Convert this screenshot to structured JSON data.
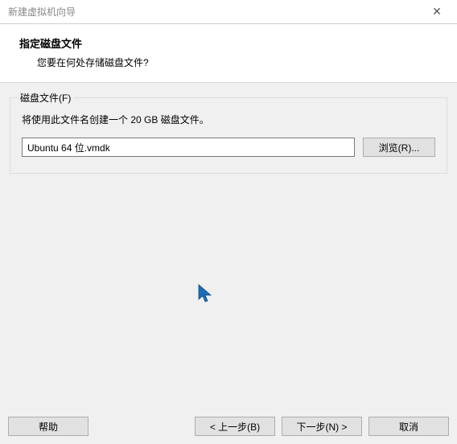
{
  "titlebar": {
    "title": "新建虚拟机向导"
  },
  "header": {
    "title": "指定磁盘文件",
    "subtitle": "您要在何处存储磁盘文件?"
  },
  "group": {
    "title": "磁盘文件(F)",
    "description": "将使用此文件名创建一个 20 GB 磁盘文件。",
    "filename": "Ubuntu 64 位.vmdk",
    "browse_label": "浏览(R)..."
  },
  "footer": {
    "help": "帮助",
    "back": "< 上一步(B)",
    "next": "下一步(N) >",
    "cancel": "取消"
  }
}
